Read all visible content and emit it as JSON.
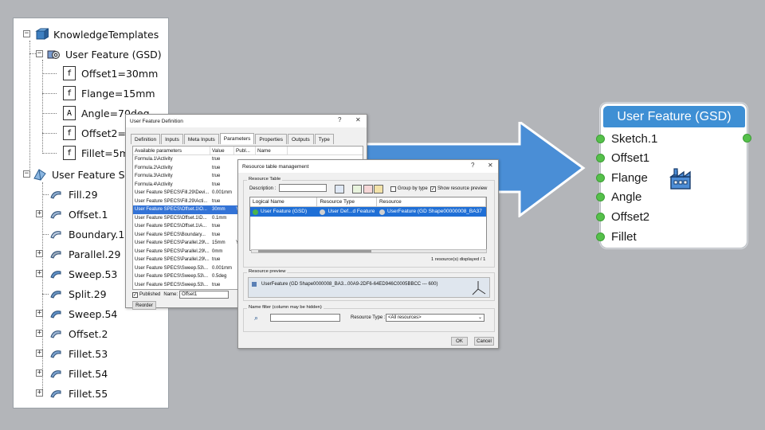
{
  "tree": {
    "root": "KnowledgeTemplates",
    "udf_group": "User Feature (GSD)",
    "params": [
      "Offset1=30mm",
      "Flange=15mm",
      "Angle=70deg",
      "Offset2=",
      "Fillet=5m"
    ],
    "param_glyphs": [
      "f",
      "f",
      "A",
      "f",
      "f"
    ],
    "specs": "User Feature SF",
    "features": [
      "Fill.29",
      "Offset.1",
      "Boundary.1",
      "Parallel.29",
      "Sweep.53",
      "Split.29",
      "Sweep.54",
      "Offset.2",
      "Fillet.53",
      "Fillet.54",
      "Fillet.55"
    ]
  },
  "ufd_dialog": {
    "title": "User Feature Definition",
    "help": "?",
    "close": "✕",
    "tabs": [
      "Definition",
      "Inputs",
      "Meta Inputs",
      "Parameters",
      "Properties",
      "Outputs",
      "Type"
    ],
    "active_tab": 3,
    "columns": [
      "Available parameters",
      "Value",
      "Publ...",
      "Name"
    ],
    "rows": [
      [
        "Formula.1\\Activity",
        "true",
        "",
        ""
      ],
      [
        "Formula.2\\Activity",
        "true",
        "",
        ""
      ],
      [
        "Formula.3\\Activity",
        "true",
        "",
        ""
      ],
      [
        "Formula.4\\Activity",
        "true",
        "",
        ""
      ],
      [
        "User Feature SPECS\\Fill.29\\Devi...",
        "0.001mm",
        "",
        ""
      ],
      [
        "User Feature SPECS\\Fill.29\\Acti...",
        "true",
        "",
        ""
      ],
      [
        "User Feature SPECS\\Offset.1\\O...",
        "30mm",
        "Y...",
        ""
      ],
      [
        "User Feature SPECS\\Offset.1\\D...",
        "0.1mm",
        "",
        ""
      ],
      [
        "User Feature SPECS\\Offset.1\\A...",
        "true",
        "",
        ""
      ],
      [
        "User Feature SPECS\\Boundary...",
        "true",
        "",
        ""
      ],
      [
        "User Feature SPECS\\Parallel.29\\...",
        "15mm",
        "Y",
        ""
      ],
      [
        "User Feature SPECS\\Parallel.29\\...",
        "0mm",
        "",
        ""
      ],
      [
        "User Feature SPECS\\Parallel.29\\...",
        "true",
        "",
        ""
      ],
      [
        "User Feature SPECS\\Sweep.53\\...",
        "0.001mm",
        "",
        ""
      ],
      [
        "User Feature SPECS\\Sweep.53\\...",
        "0.5deg",
        "",
        ""
      ],
      [
        "User Feature SPECS\\Sweep.53\\...",
        "true",
        "",
        ""
      ],
      [
        "User Feature SPECS\\Sweep.54\\...",
        "40mm",
        "",
        ""
      ]
    ],
    "selected_row": 6,
    "published_label": "Published",
    "name_label": "Name:",
    "name_value": "Offset1",
    "reorder_label": "Reorder"
  },
  "rtm_dialog": {
    "title": "Resource table management",
    "help": "?",
    "close": "✕",
    "group_table": "Resource Table",
    "description_label": "Description :",
    "group_by_type": "Group by type",
    "show_preview": "Show resource preview",
    "columns": [
      "Logical Name",
      "Resource Type",
      "Resource"
    ],
    "row": [
      "User Feature (GSD)",
      "User Def...d Feature",
      "UserFeature (GD Shape00000008_BA37"
    ],
    "count": "1 resource(s) displayed / 1",
    "group_preview": "Resource preview",
    "preview_text": "UserFeature (GD Shape0000008_BA3...00A9-2DF6-64ED946C0005BBCC --- 600)",
    "group_filter": "Name filter (column may be hidden)",
    "resource_type_label": "Resource Type :",
    "resource_type_value": "<All resources>",
    "ok": "OK",
    "cancel": "Cancel"
  },
  "node": {
    "title": "User Feature (GSD)",
    "inputs": [
      "Sketch.1",
      "Offset1",
      "Flange",
      "Angle",
      "Offset2",
      "Fillet"
    ]
  },
  "colors": {
    "background": "#b3b5b9",
    "arrow": "#4a8ed6",
    "node_header": "#3e8fd4",
    "port": "#55c04a",
    "selection": "#3373d6"
  }
}
